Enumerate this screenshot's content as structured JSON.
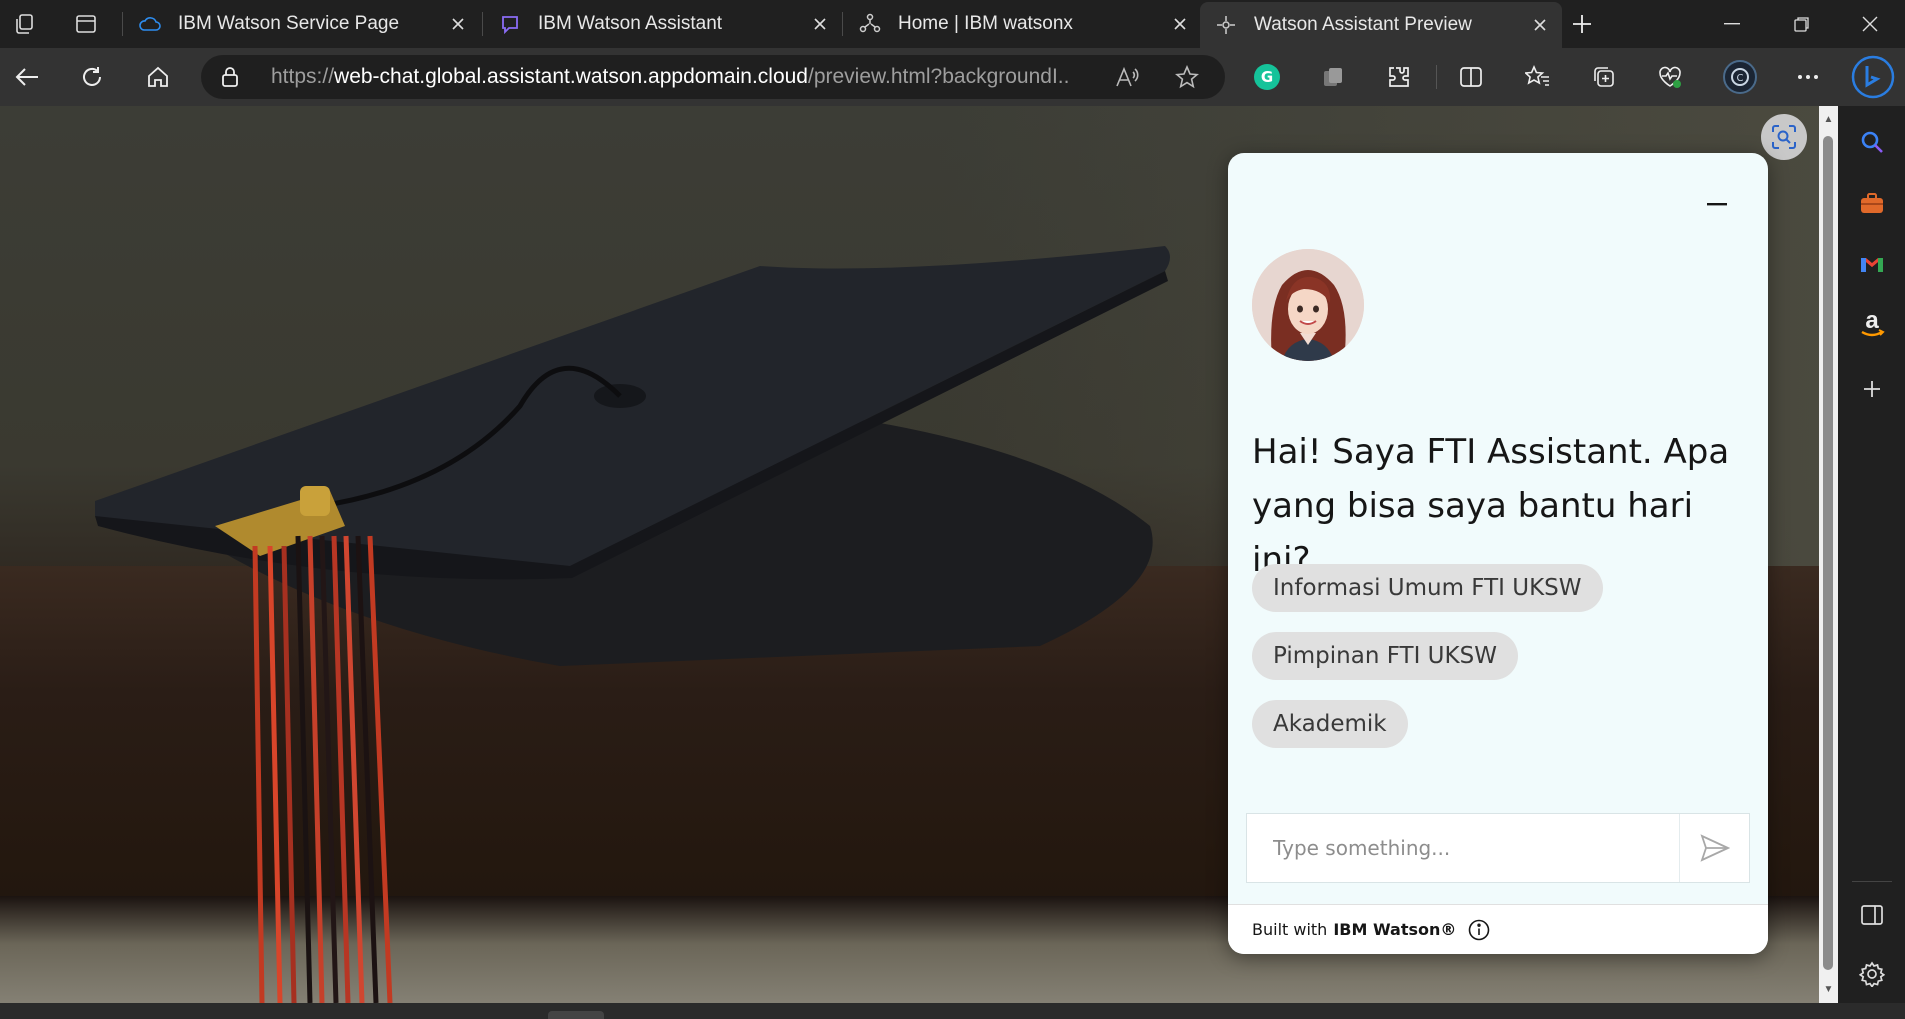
{
  "browser": {
    "tabs": [
      {
        "title": "IBM Watson Service Page",
        "icon": "ibm-cloud-icon",
        "active": false
      },
      {
        "title": "IBM Watson Assistant",
        "icon": "watson-assistant-icon",
        "active": false
      },
      {
        "title": "Home | IBM watsonx",
        "icon": "watsonx-icon",
        "active": false
      },
      {
        "title": "Watson Assistant Preview",
        "icon": "watson-preview-icon",
        "active": true
      }
    ],
    "address": {
      "scheme": "https://",
      "host": "web-chat.global.assistant.watson.appdomain.cloud",
      "path": "/preview.html?backgroundI..."
    }
  },
  "chat": {
    "greeting": "Hai! Saya FTI Assistant. Apa yang bisa saya bantu hari ini?",
    "options": [
      "Informasi Umum FTI UKSW",
      "Pimpinan FTI UKSW",
      "Akademik"
    ],
    "input_placeholder": "Type something...",
    "footer_prefix": "Built with",
    "footer_brand": "IBM Watson®",
    "colors": {
      "panel": "#f1fbfc",
      "chip": "#e0e0e0",
      "text": "#161616"
    }
  },
  "sidebar": {
    "icons": [
      "search-icon",
      "briefcase-icon",
      "gmail-icon",
      "amazon-icon",
      "add-icon",
      "panel-icon",
      "settings-icon"
    ]
  }
}
